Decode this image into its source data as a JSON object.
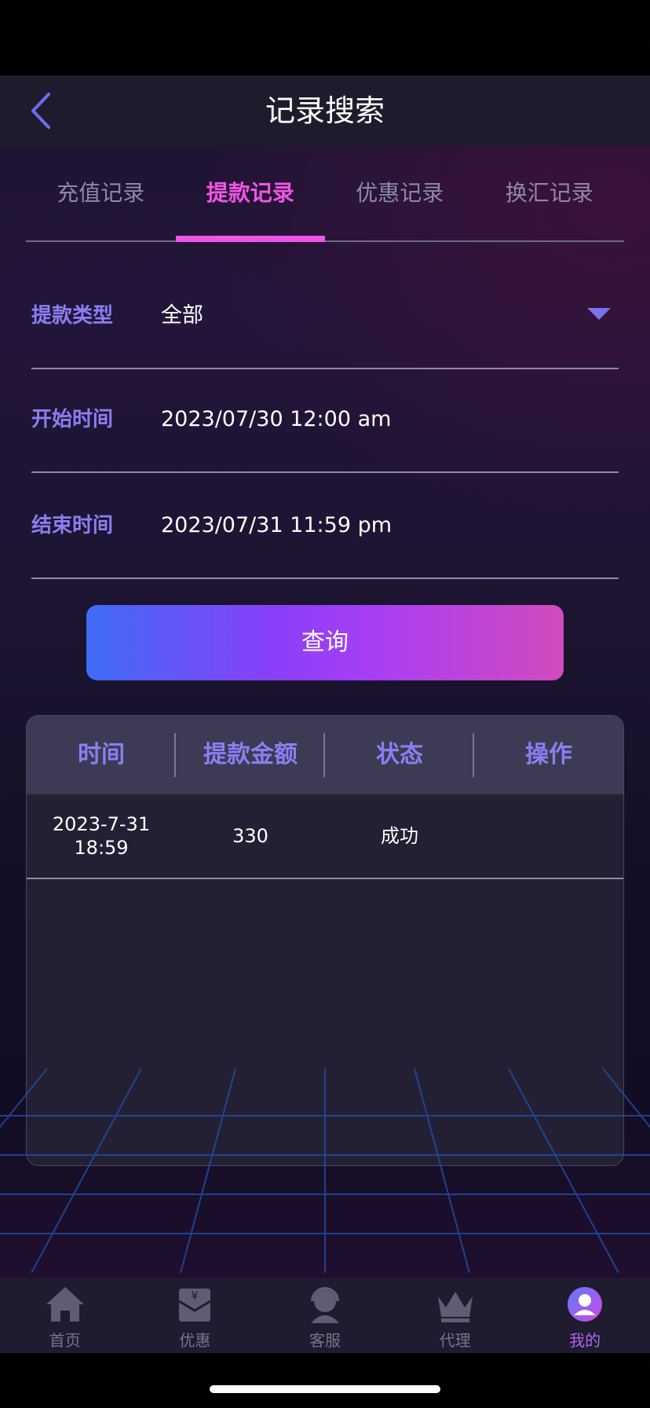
{
  "header": {
    "title": "记录搜索"
  },
  "tabs": [
    {
      "label": "充值记录",
      "active": false
    },
    {
      "label": "提款记录",
      "active": true
    },
    {
      "label": "优惠记录",
      "active": false
    },
    {
      "label": "换汇记录",
      "active": false
    }
  ],
  "form": {
    "type": {
      "label": "提款类型",
      "value": "全部"
    },
    "start": {
      "label": "开始时间",
      "value": "2023/07/30 12:00 am"
    },
    "end": {
      "label": "结束时间",
      "value": "2023/07/31 11:59 pm"
    },
    "query_label": "查询"
  },
  "table": {
    "headers": [
      "时间",
      "提款金额",
      "状态",
      "操作"
    ],
    "rows": [
      {
        "time_date": "2023-7-31",
        "time_clock": "18:59",
        "amount": "330",
        "status": "成功",
        "action": ""
      }
    ]
  },
  "tabbar": [
    {
      "label": "首页",
      "icon": "home-icon"
    },
    {
      "label": "优惠",
      "icon": "promo-icon"
    },
    {
      "label": "客服",
      "icon": "customer-service-icon"
    },
    {
      "label": "代理",
      "icon": "crown-icon"
    },
    {
      "label": "我的",
      "icon": "user-icon",
      "active": true
    }
  ],
  "colors": {
    "accent": "#f055e6",
    "label": "#8a7ff0",
    "active_tabbar": "#b061f2"
  }
}
